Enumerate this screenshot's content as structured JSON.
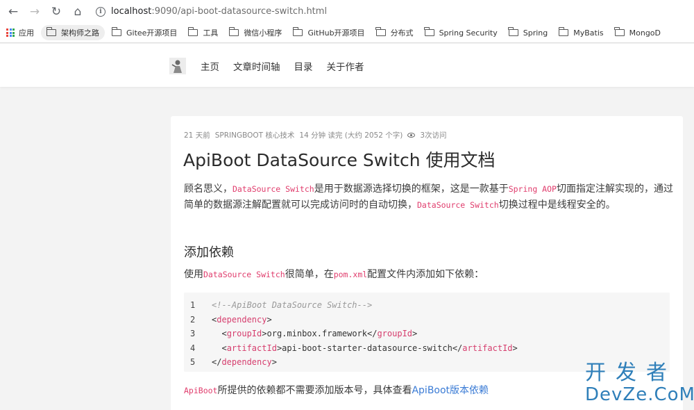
{
  "browser": {
    "url_host": "localhost",
    "url_rest": ":9090/api-boot-datasource-switch.html",
    "bookmarks": [
      "应用",
      "架构师之路",
      "Gitee开源项目",
      "工具",
      "微信小程序",
      "GitHub开源项目",
      "分布式",
      "Spring Security",
      "Spring",
      "MyBatis",
      "MongoD"
    ]
  },
  "site": {
    "nav": [
      "主页",
      "文章时间轴",
      "目录",
      "关于作者"
    ]
  },
  "article": {
    "meta": {
      "posted": "21 天前",
      "category": "SPRINGBOOT 核心技术",
      "read_time": "14 分钟 读完 (大约 2052 个字)",
      "views": "3次访问"
    },
    "title": "ApiBoot DataSource Switch 使用文档",
    "intro": {
      "t1": "顾名思义，",
      "c1": "DataSource Switch",
      "t2": "是用于数据源选择切换的框架，这是一款基于",
      "c2": "Spring AOP",
      "t3": "切面指定注解实现的，通过简单的数据源注解配置就可以完成访问时的自动切换，",
      "c3": "DataSource Switch",
      "t4": "切换过程中是线程安全的。"
    },
    "section_heading": "添加依赖",
    "usage": {
      "t1": "使用",
      "c1": "DataSource Switch",
      "t2": "很简单，在",
      "c2": "pom.xml",
      "t3": "配置文件内添加如下依赖："
    },
    "code_lines": {
      "n1": "1",
      "n2": "2",
      "n3": "3",
      "n4": "4",
      "n5": "5",
      "comment": "<!--ApiBoot DataSource Switch-->",
      "dep_open_lt": "<",
      "dep_tag": "dependency",
      "gt": ">",
      "groupId_tag": "groupId",
      "groupId_val": "org.minbox.framework",
      "artifactId_tag": "artifactId",
      "artifactId_val": "api-boot-starter-datasource-switch",
      "close_lt": "</"
    },
    "footer_note": {
      "c1": "ApiBoot",
      "t1": "所提供的依赖都不需要添加版本号，具体查看",
      "link": "ApiBoot版本依赖"
    }
  },
  "watermark": {
    "cn": "开发者",
    "en": "DevZe.CoM"
  },
  "colors": {
    "code_highlight": "#e03c6c",
    "link": "#3a7bd5",
    "watermark": "#2f7fb9"
  }
}
